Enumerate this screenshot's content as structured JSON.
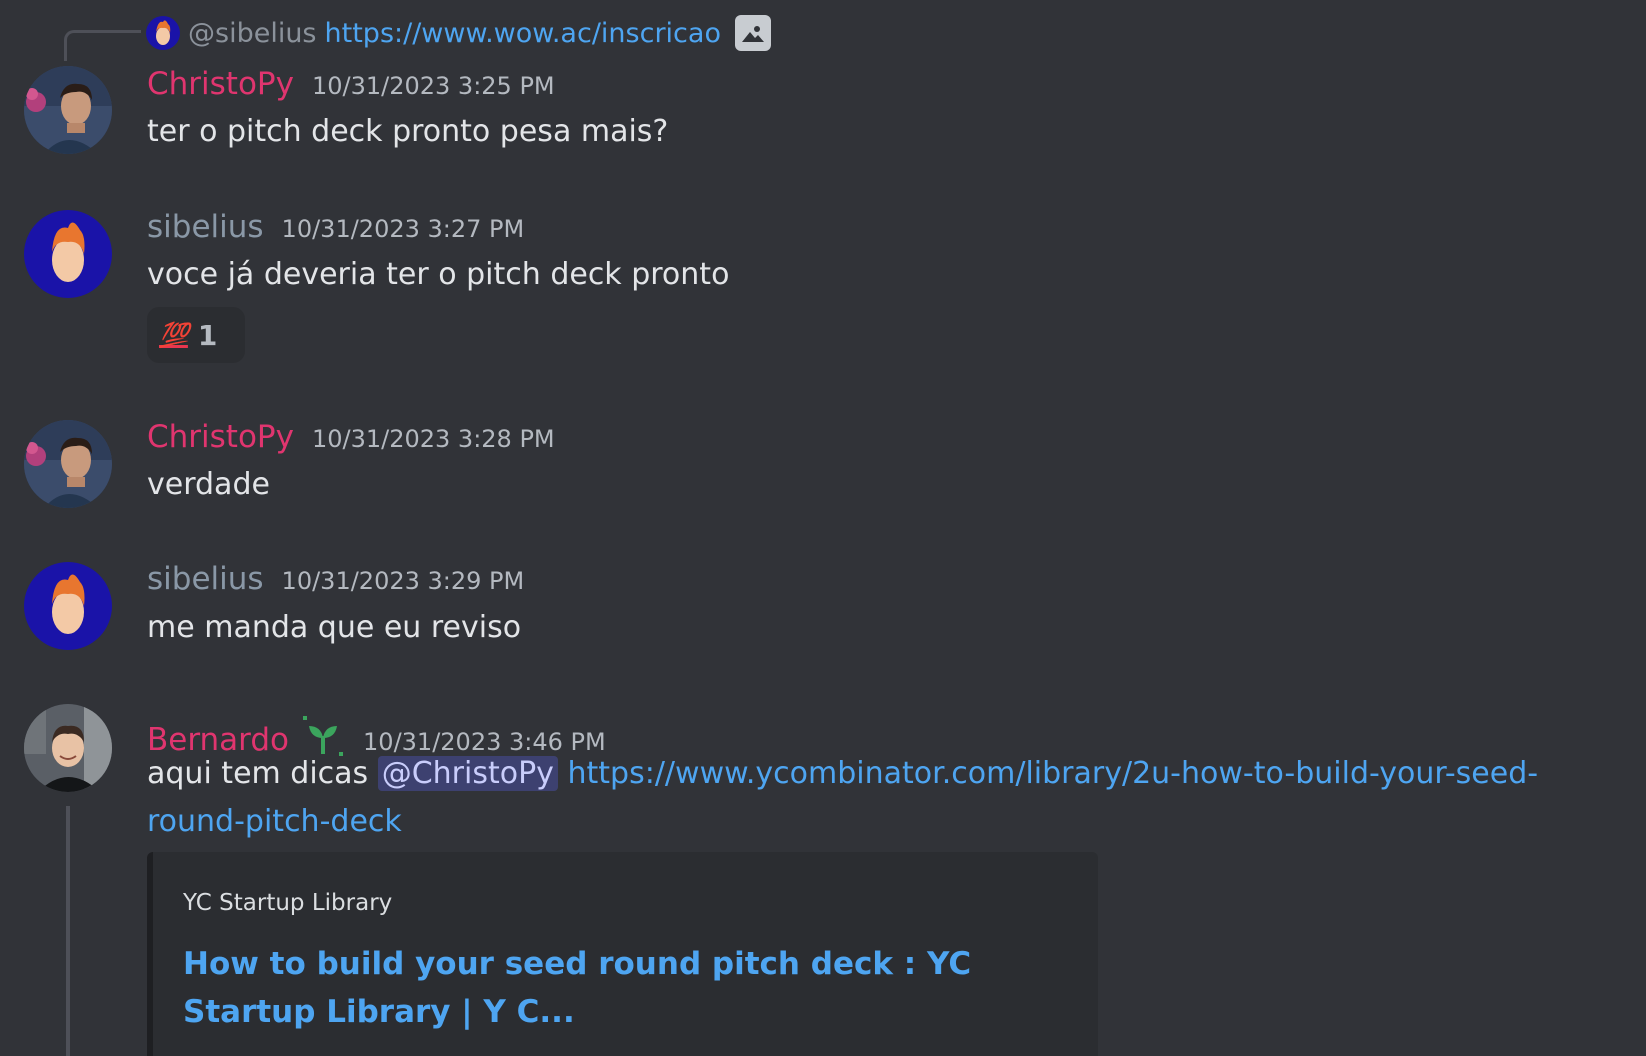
{
  "reply": {
    "author": "@sibelius",
    "link": "https://www.wow.ac/inscricao",
    "attachment_icon": "image-icon"
  },
  "messages": [
    {
      "author": "ChristoPy",
      "timestamp": "10/31/2023 3:25 PM",
      "text": "ter o pitch deck pronto pesa mais?"
    },
    {
      "author": "sibelius",
      "timestamp": "10/31/2023 3:27 PM",
      "text": "voce já deveria ter o pitch deck pronto",
      "reaction": {
        "emoji": "💯",
        "count": "1"
      }
    },
    {
      "author": "ChristoPy",
      "timestamp": "10/31/2023 3:28 PM",
      "text": "verdade"
    },
    {
      "author": "sibelius",
      "timestamp": "10/31/2023 3:29 PM",
      "text": "me manda que eu reviso"
    },
    {
      "author": "Bernardo",
      "badge_icon": "sprout-icon",
      "timestamp": "10/31/2023 3:46 PM",
      "text_prefix": "aqui tem dicas ",
      "mention": "@ChristoPy",
      "link": "https://www.ycombinator.com/library/2u-how-to-build-your-seed-round-pitch-deck",
      "embed": {
        "provider": "YC Startup Library",
        "title": "How to build your seed round pitch deck  : YC Startup Library | Y C..."
      }
    }
  ],
  "colors": {
    "background": "#313338",
    "name_red": "#e0356f",
    "name_grey": "#8a98a7",
    "link": "#4ea5f1"
  }
}
